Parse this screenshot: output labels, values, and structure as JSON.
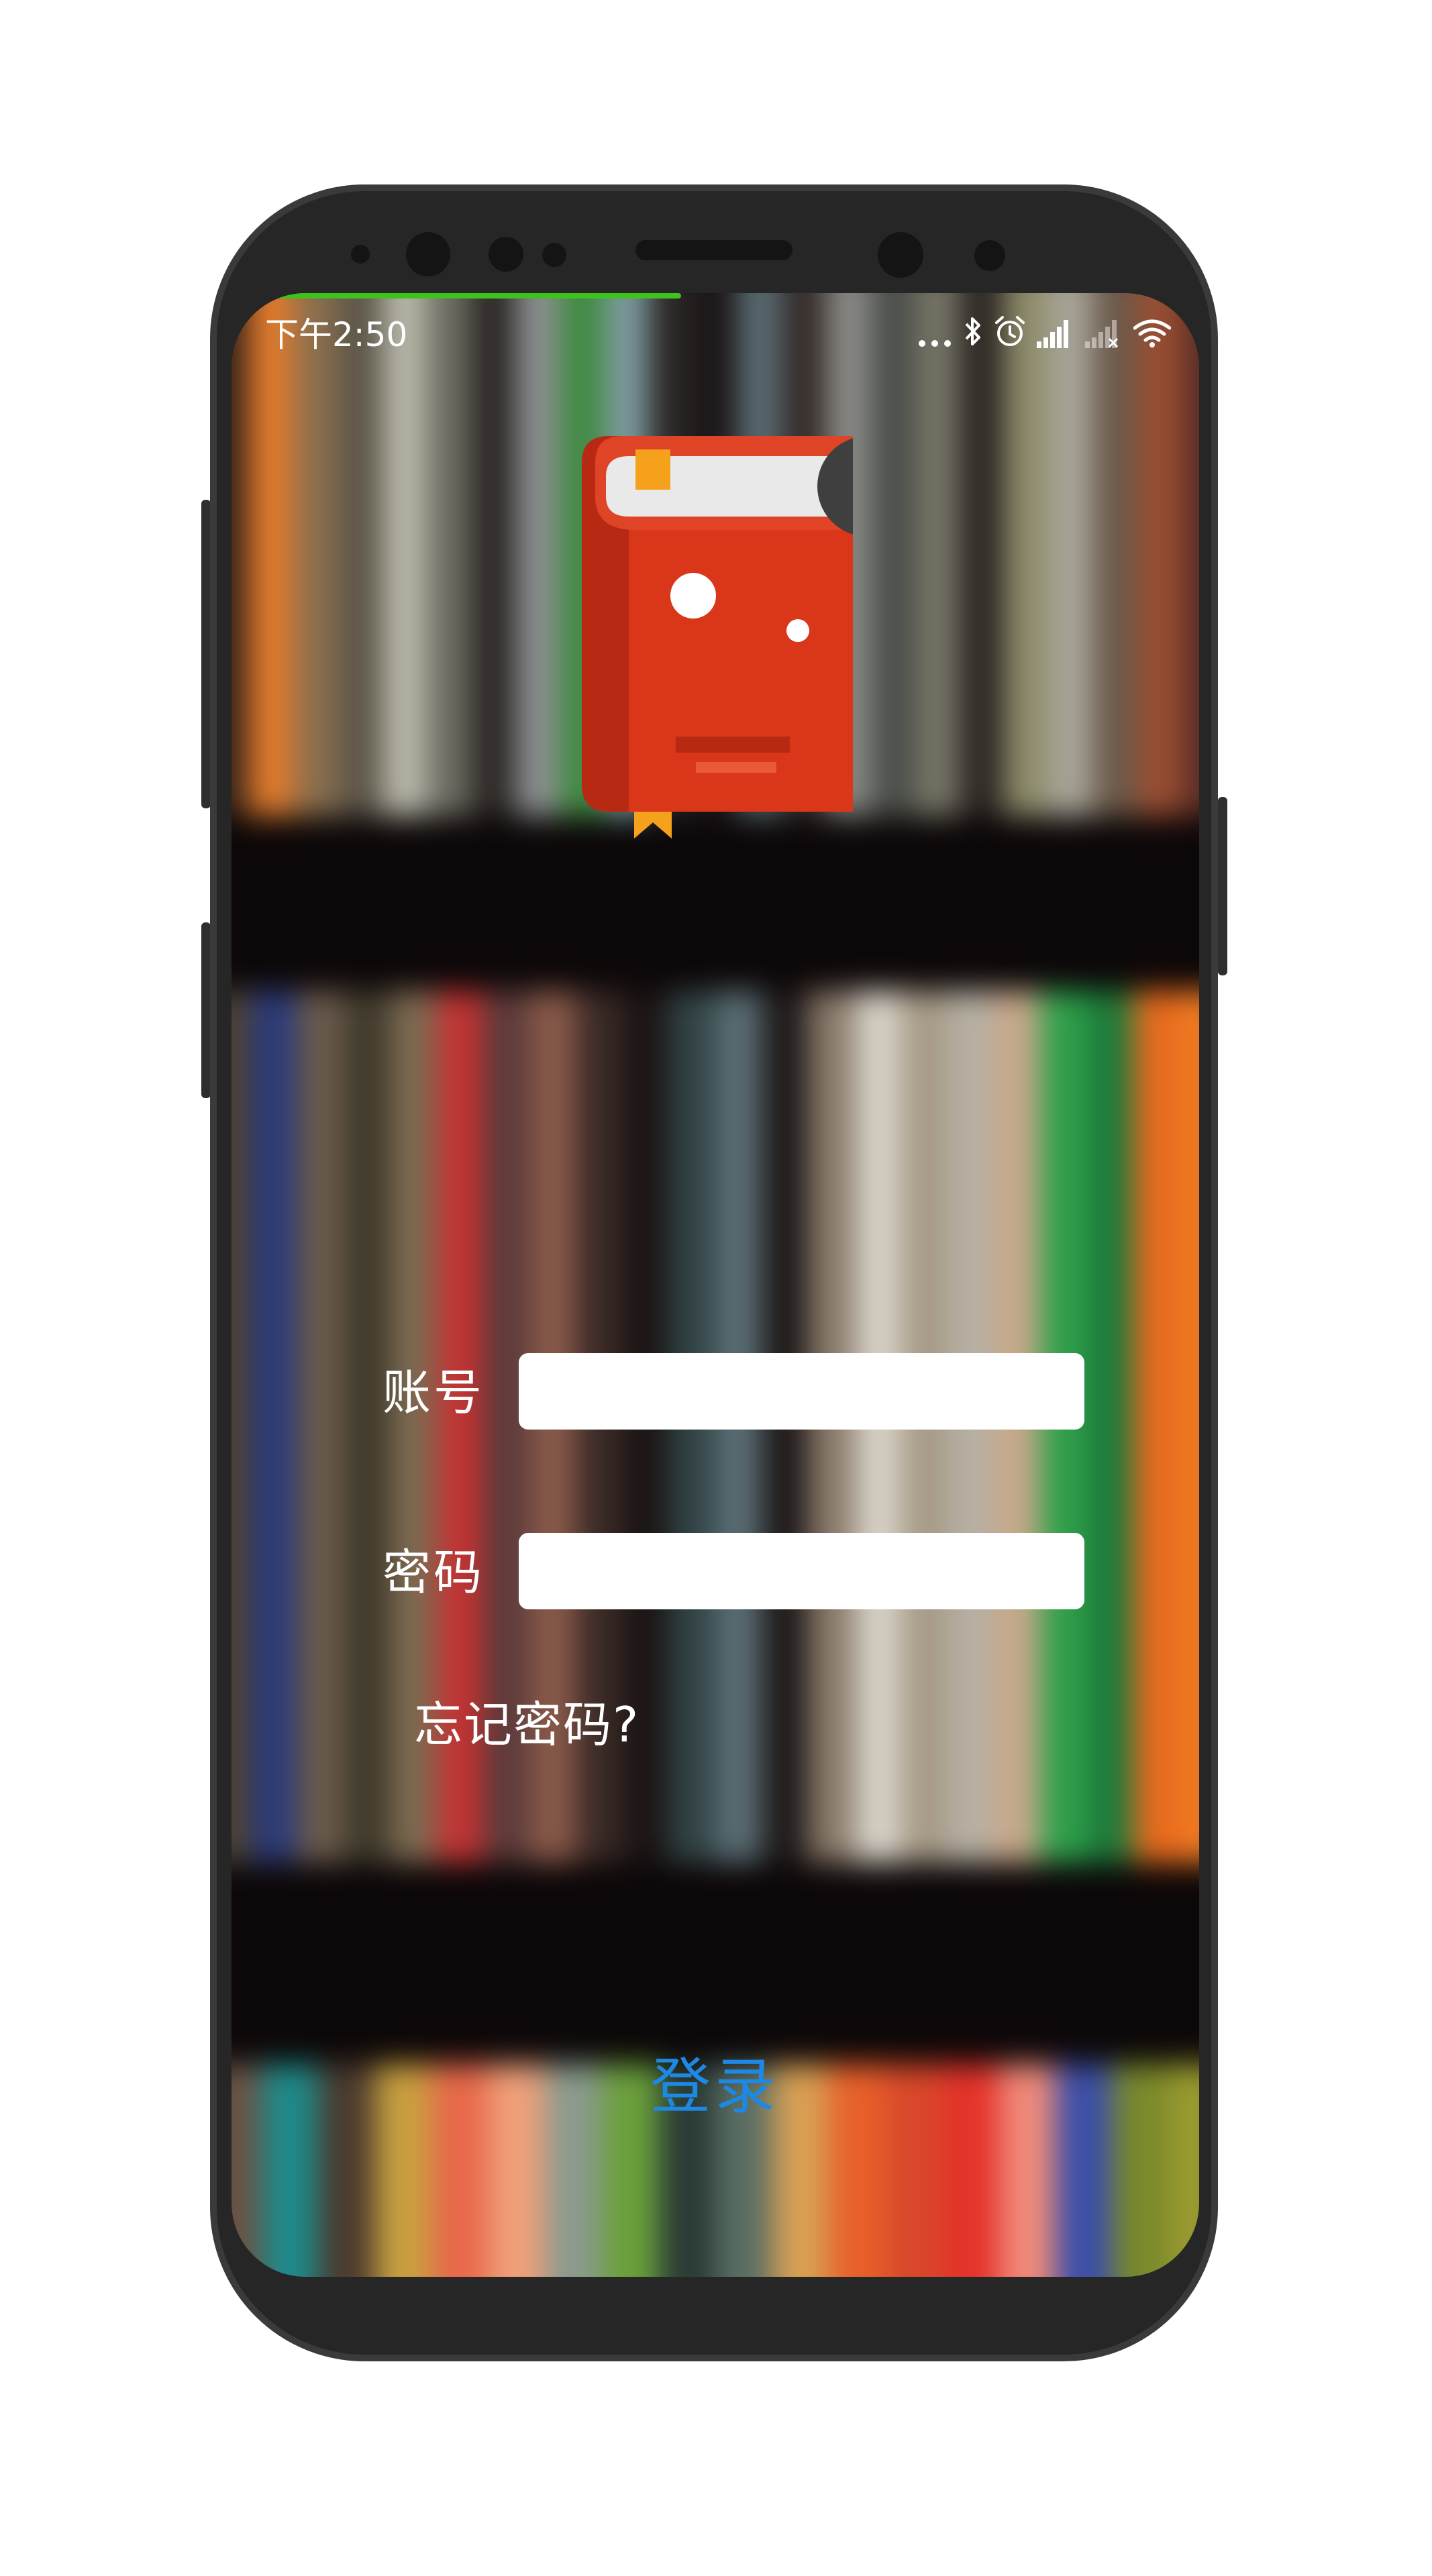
{
  "status_bar": {
    "time": "下午2:50",
    "icons": [
      "more-dots-icon",
      "bluetooth-icon",
      "alarm-icon",
      "signal-icon",
      "signal-weak-icon",
      "wifi-icon"
    ]
  },
  "app": {
    "logo_icon": "book-icon"
  },
  "login_form": {
    "account_label": "账号",
    "account_value": "",
    "password_label": "密码",
    "password_value": "",
    "forgot_password_text": "忘记密码?",
    "login_button_label": "登录"
  },
  "colors": {
    "login_button_text": "#1e88e5",
    "progress_bar": "#3ec21d",
    "book_red": "#d9361a",
    "book_page": "#e9e9e9",
    "bookmark": "#f5a11c"
  }
}
